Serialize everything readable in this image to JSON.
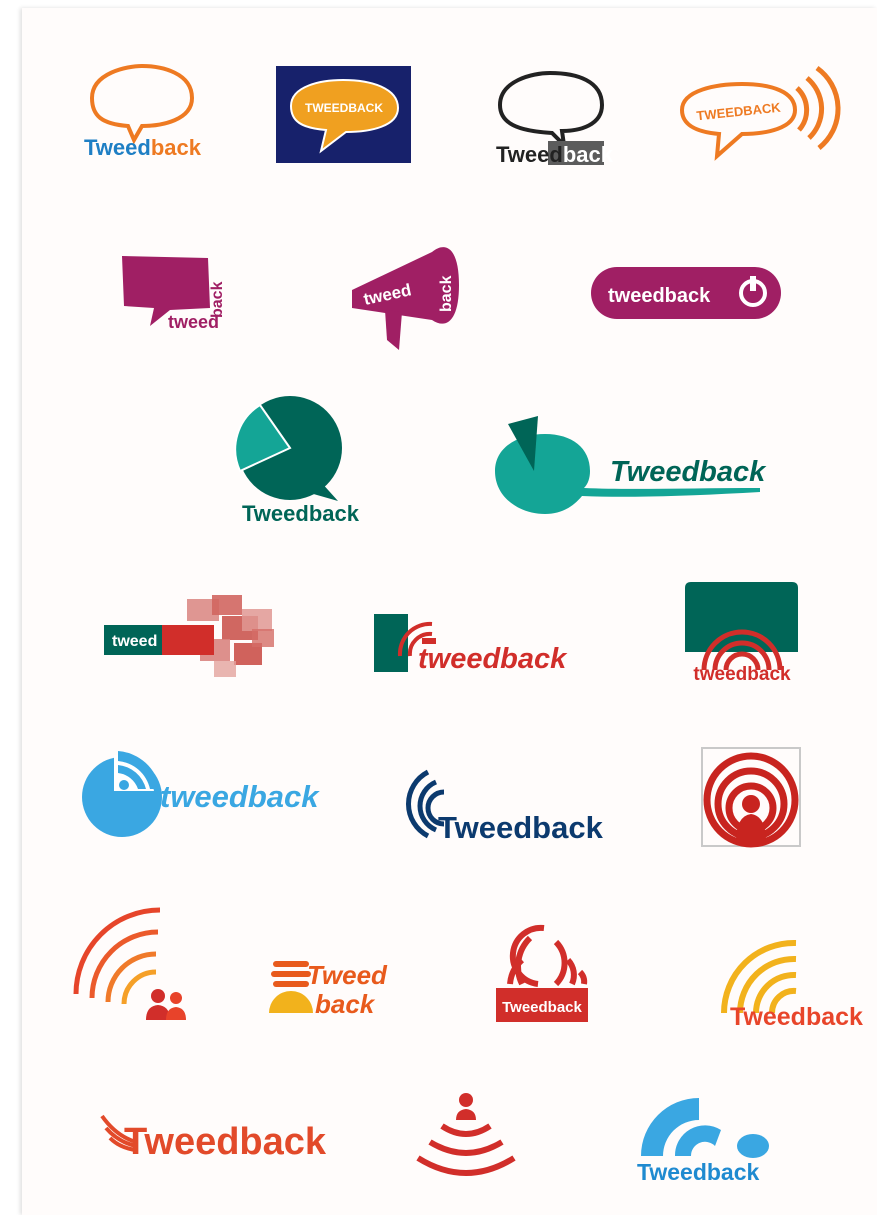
{
  "colors": {
    "orange": "#ee7a22",
    "blue": "#1f7fc4",
    "navy": "#17216b",
    "gray": "#5c5c5c",
    "magenta": "#a01f64",
    "teal_dark": "#006557",
    "teal": "#14a596",
    "red": "#d12e2a",
    "sky": "#3aa7e2",
    "dark_blue": "#0c3a6e",
    "yellow": "#f2b21c"
  },
  "logos": [
    {
      "id": 1,
      "parts": [
        "Tweed",
        "back"
      ],
      "icon": "speech-bubble-icon"
    },
    {
      "id": 2,
      "parts": [
        "TWEEDBACK"
      ],
      "icon": "speech-bubble-icon"
    },
    {
      "id": 3,
      "parts": [
        "Tweed",
        "back"
      ],
      "icon": "speech-bubble-icon"
    },
    {
      "id": 4,
      "parts": [
        "TWEEDBACK"
      ],
      "icon": "speech-bubble-signal-icon"
    },
    {
      "id": 5,
      "parts": [
        "tweed",
        "back"
      ],
      "icon": "speech-bubble-icon"
    },
    {
      "id": 6,
      "parts": [
        "tweed",
        "back"
      ],
      "icon": "megaphone-icon"
    },
    {
      "id": 7,
      "parts": [
        "tweedback"
      ],
      "icon": "power-icon"
    },
    {
      "id": 8,
      "parts": [
        "Tweedback"
      ],
      "icon": "pie-chart-bubble-icon"
    },
    {
      "id": 9,
      "parts": [
        "Tweedback"
      ],
      "icon": "pie-chart-bubble-icon"
    },
    {
      "id": 10,
      "parts": [
        "twee",
        "d"
      ],
      "icon": "bubble-cluster-icon"
    },
    {
      "id": 11,
      "parts": [
        "tweedback"
      ],
      "icon": "signal-arc-icon"
    },
    {
      "id": 12,
      "parts": [
        "tweedback"
      ],
      "icon": "signal-arc-icon"
    },
    {
      "id": 13,
      "parts": [
        "tweedback"
      ],
      "icon": "pie-signal-icon"
    },
    {
      "id": 14,
      "parts": [
        "Tweedback"
      ],
      "icon": "signal-wave-icon"
    },
    {
      "id": 15,
      "parts": [],
      "icon": "signal-person-icon"
    },
    {
      "id": 16,
      "parts": [],
      "icon": "signal-people-icon"
    },
    {
      "id": 17,
      "parts": [
        "Tweed",
        "back"
      ],
      "icon": "signal-dome-icon"
    },
    {
      "id": 18,
      "parts": [
        "Tweedback"
      ],
      "icon": "signal-bars-icon"
    },
    {
      "id": 19,
      "parts": [
        "Tweedback"
      ],
      "icon": "signal-arc-icon"
    },
    {
      "id": 20,
      "parts": [
        "Tweedback"
      ],
      "icon": "signal-wave-icon"
    },
    {
      "id": 21,
      "parts": [],
      "icon": "signal-person-icon"
    },
    {
      "id": 22,
      "parts": [
        "Tweedback"
      ],
      "icon": "signal-arc-icon"
    }
  ]
}
